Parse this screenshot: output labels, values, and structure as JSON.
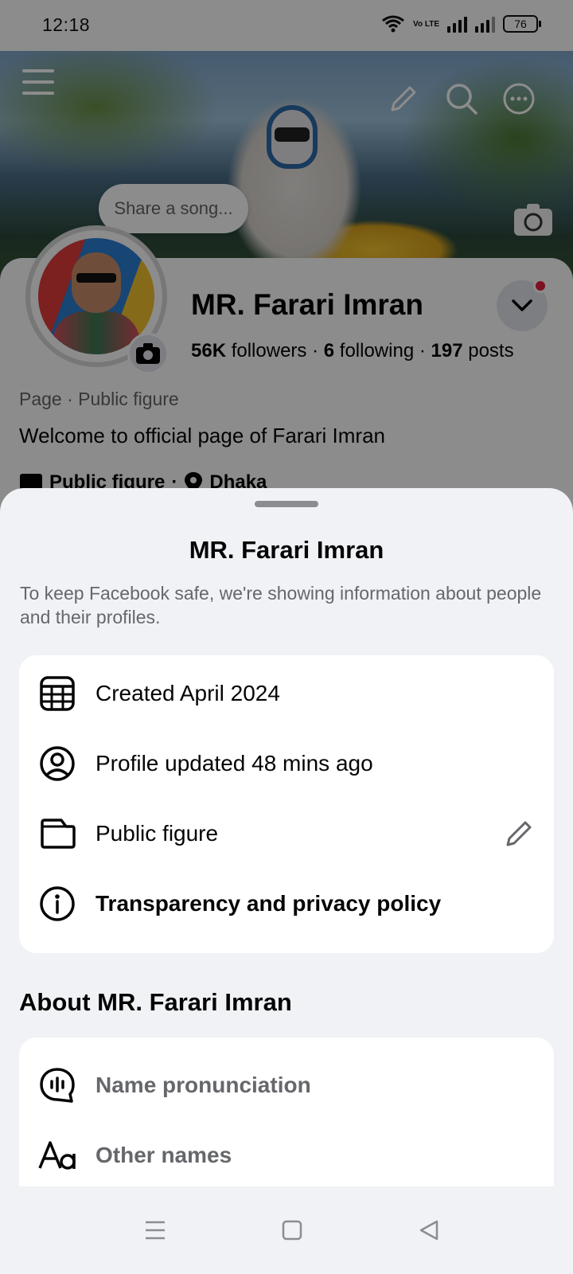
{
  "status_bar": {
    "time": "12:18",
    "battery": "76",
    "network_label": "Vo LTE"
  },
  "cover": {
    "share_song_placeholder": "Share a song..."
  },
  "profile": {
    "name": "MR. Farari Imran",
    "followers_count": "56K",
    "followers_label": "followers",
    "following_count": "6",
    "following_label": "following",
    "posts_count": "197",
    "posts_label": "posts",
    "separator": "·",
    "category_line": "Page · Public figure",
    "bio": "Welcome to official page of Farari Imran",
    "meta_category": "Public figure",
    "meta_separator": "·",
    "meta_location": "Dhaka"
  },
  "sheet": {
    "title": "MR. Farari Imran",
    "description": "To keep Facebook safe, we're showing information about people and their profiles.",
    "info_rows": [
      {
        "label": "Created April 2024",
        "icon": "calendar-icon"
      },
      {
        "label": "Profile updated 48 mins ago",
        "icon": "profile-circle-icon"
      },
      {
        "label": "Public figure",
        "icon": "folder-icon"
      },
      {
        "label": "Transparency and privacy policy",
        "icon": "info-icon"
      }
    ],
    "about_title": "About MR. Farari Imran",
    "about_rows": [
      {
        "label": "Name pronunciation",
        "icon": "voice-bubble-icon"
      },
      {
        "label": "Other names",
        "icon": "text-aa-icon"
      }
    ]
  },
  "colors": {
    "sheet_bg": "#f0f2f5",
    "card_bg": "#ffffff",
    "primary_text": "#050505",
    "secondary_text": "#65676b",
    "notification_red": "#e41e3f"
  }
}
